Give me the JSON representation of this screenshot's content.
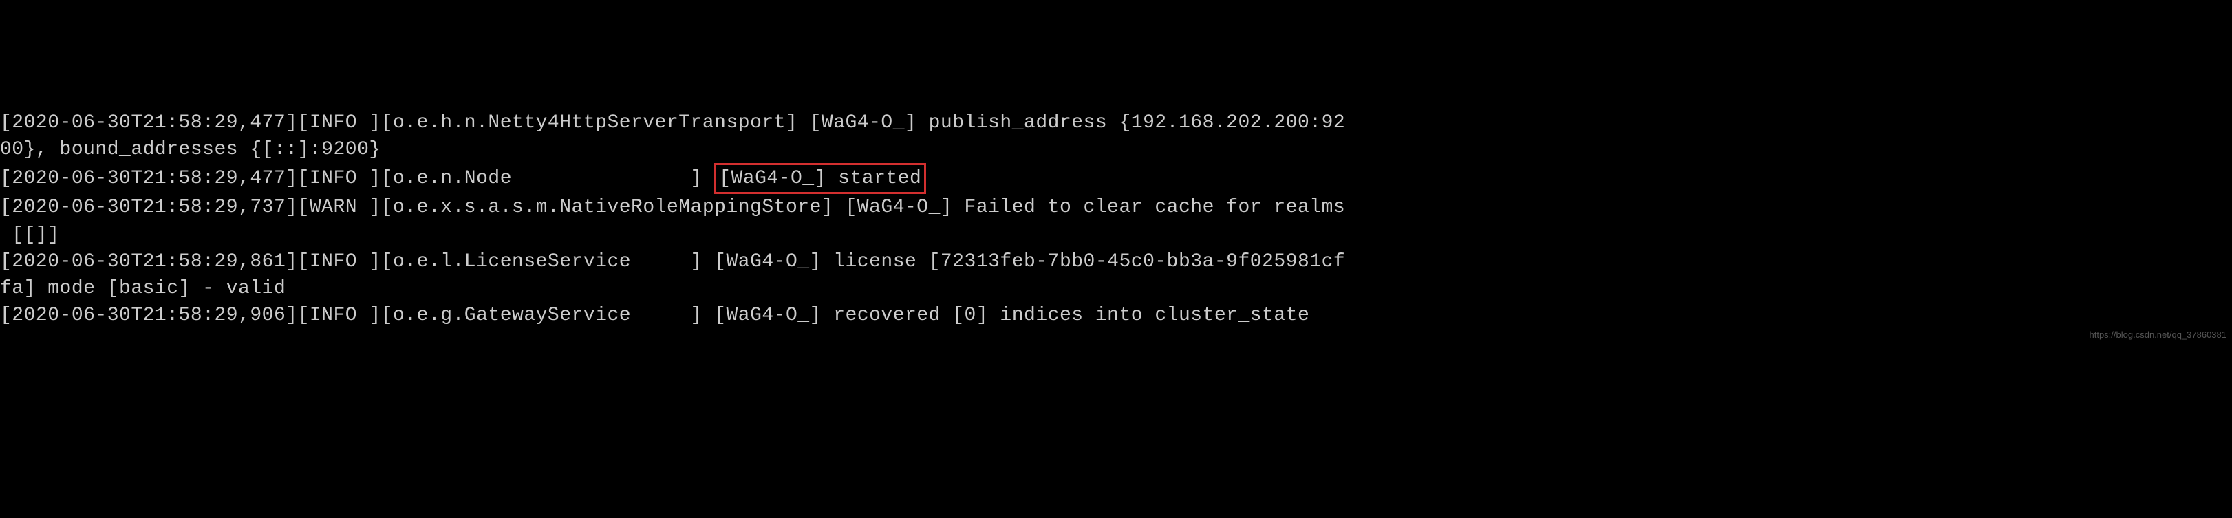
{
  "logs": {
    "line1_part1": "[2020-06-30T21:58:29,477][INFO ][o.e.h.n.Netty4HttpServerTransport] [WaG4-O_] publish_address {192.168.202.200:92",
    "line1_part2": "00}, bound_addresses {[::]:9200}",
    "line2_prefix": "[2020-06-30T21:58:29,477][INFO ][o.e.n.Node               ] ",
    "line2_highlight": "[WaG4-O_] started",
    "line3_part1": "[2020-06-30T21:58:29,737][WARN ][o.e.x.s.a.s.m.NativeRoleMappingStore] [WaG4-O_] Failed to clear cache for realms",
    "line3_part2": " [[]]",
    "line4_part1": "[2020-06-30T21:58:29,861][INFO ][o.e.l.LicenseService     ] [WaG4-O_] license [72313feb-7bb0-45c0-bb3a-9f025981cf",
    "line4_part2": "fa] mode [basic] - valid",
    "line5": "[2020-06-30T21:58:29,906][INFO ][o.e.g.GatewayService     ] [WaG4-O_] recovered [0] indices into cluster_state"
  },
  "watermark": "https://blog.csdn.net/qq_37860381"
}
